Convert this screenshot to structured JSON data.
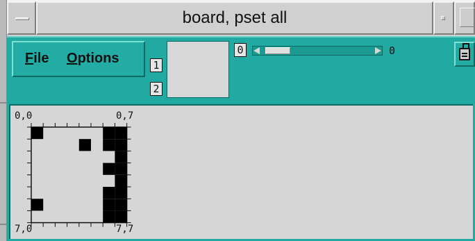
{
  "window": {
    "title": "board, pset all"
  },
  "menubar": {
    "file": {
      "mnemonic": "F",
      "rest": "ile"
    },
    "options": {
      "mnemonic": "O",
      "rest": "ptions"
    }
  },
  "toggles": {
    "one": "1",
    "two": "2",
    "zero": "0"
  },
  "slider": {
    "value": "0"
  },
  "board": {
    "corners": {
      "top_left": "0,0",
      "top_right": "0,7",
      "bottom_left": "7,0",
      "bottom_right": "7,7"
    },
    "rows": 8,
    "cols": 8,
    "filled_cells": [
      [
        0,
        0
      ],
      [
        0,
        6
      ],
      [
        0,
        7
      ],
      [
        1,
        4
      ],
      [
        1,
        6
      ],
      [
        1,
        7
      ],
      [
        2,
        7
      ],
      [
        3,
        6
      ],
      [
        3,
        7
      ],
      [
        4,
        7
      ],
      [
        5,
        6
      ],
      [
        5,
        7
      ],
      [
        6,
        0
      ],
      [
        6,
        6
      ],
      [
        6,
        7
      ],
      [
        7,
        6
      ],
      [
        7,
        7
      ]
    ]
  },
  "colors": {
    "panel": "#21aaa1",
    "board_bg": "#d6d6d6",
    "cell_fill": "#000000"
  },
  "icons": {
    "window_menu": "window-menu-icon",
    "minimize": "minimize-icon",
    "maximize": "maximize-icon",
    "lock": "lock-icon"
  }
}
